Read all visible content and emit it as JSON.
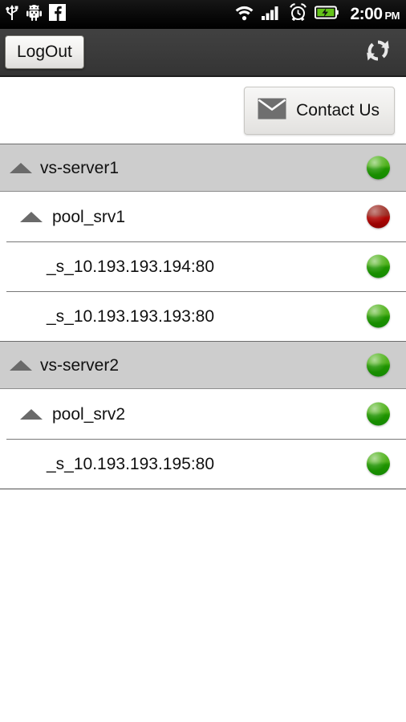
{
  "status_bar": {
    "left_icons": [
      "usb-icon",
      "android-debug-icon",
      "facebook-icon"
    ],
    "right_icons": [
      "wifi-icon",
      "signal-bars-icon",
      "alarm-clock-icon",
      "battery-charging-icon"
    ],
    "time": "2:00",
    "ampm": "PM"
  },
  "action_bar": {
    "logout_label": "LogOut",
    "refresh_icon": "refresh-icon"
  },
  "contact": {
    "label": "Contact Us",
    "icon": "envelope-icon"
  },
  "colors": {
    "action_bar": "#3b3b3b",
    "group_row": "#cdcdcd",
    "status_ok": "#1f9400",
    "status_error": "#b00604",
    "expander": "#6a6a6a"
  },
  "tree": {
    "rows": [
      {
        "label": "vs-server1",
        "level": 0,
        "status": "green",
        "expander": true
      },
      {
        "label": "pool_srv1",
        "level": 1,
        "status": "red",
        "expander": true
      },
      {
        "label": "_s_10.193.193.194:80",
        "level": 2,
        "status": "green",
        "expander": false
      },
      {
        "label": "_s_10.193.193.193:80",
        "level": 2,
        "status": "green",
        "expander": false
      },
      {
        "label": "vs-server2",
        "level": 0,
        "status": "green",
        "expander": true
      },
      {
        "label": "pool_srv2",
        "level": 1,
        "status": "green",
        "expander": true
      },
      {
        "label": "_s_10.193.193.195:80",
        "level": 2,
        "status": "green",
        "expander": false
      }
    ]
  }
}
